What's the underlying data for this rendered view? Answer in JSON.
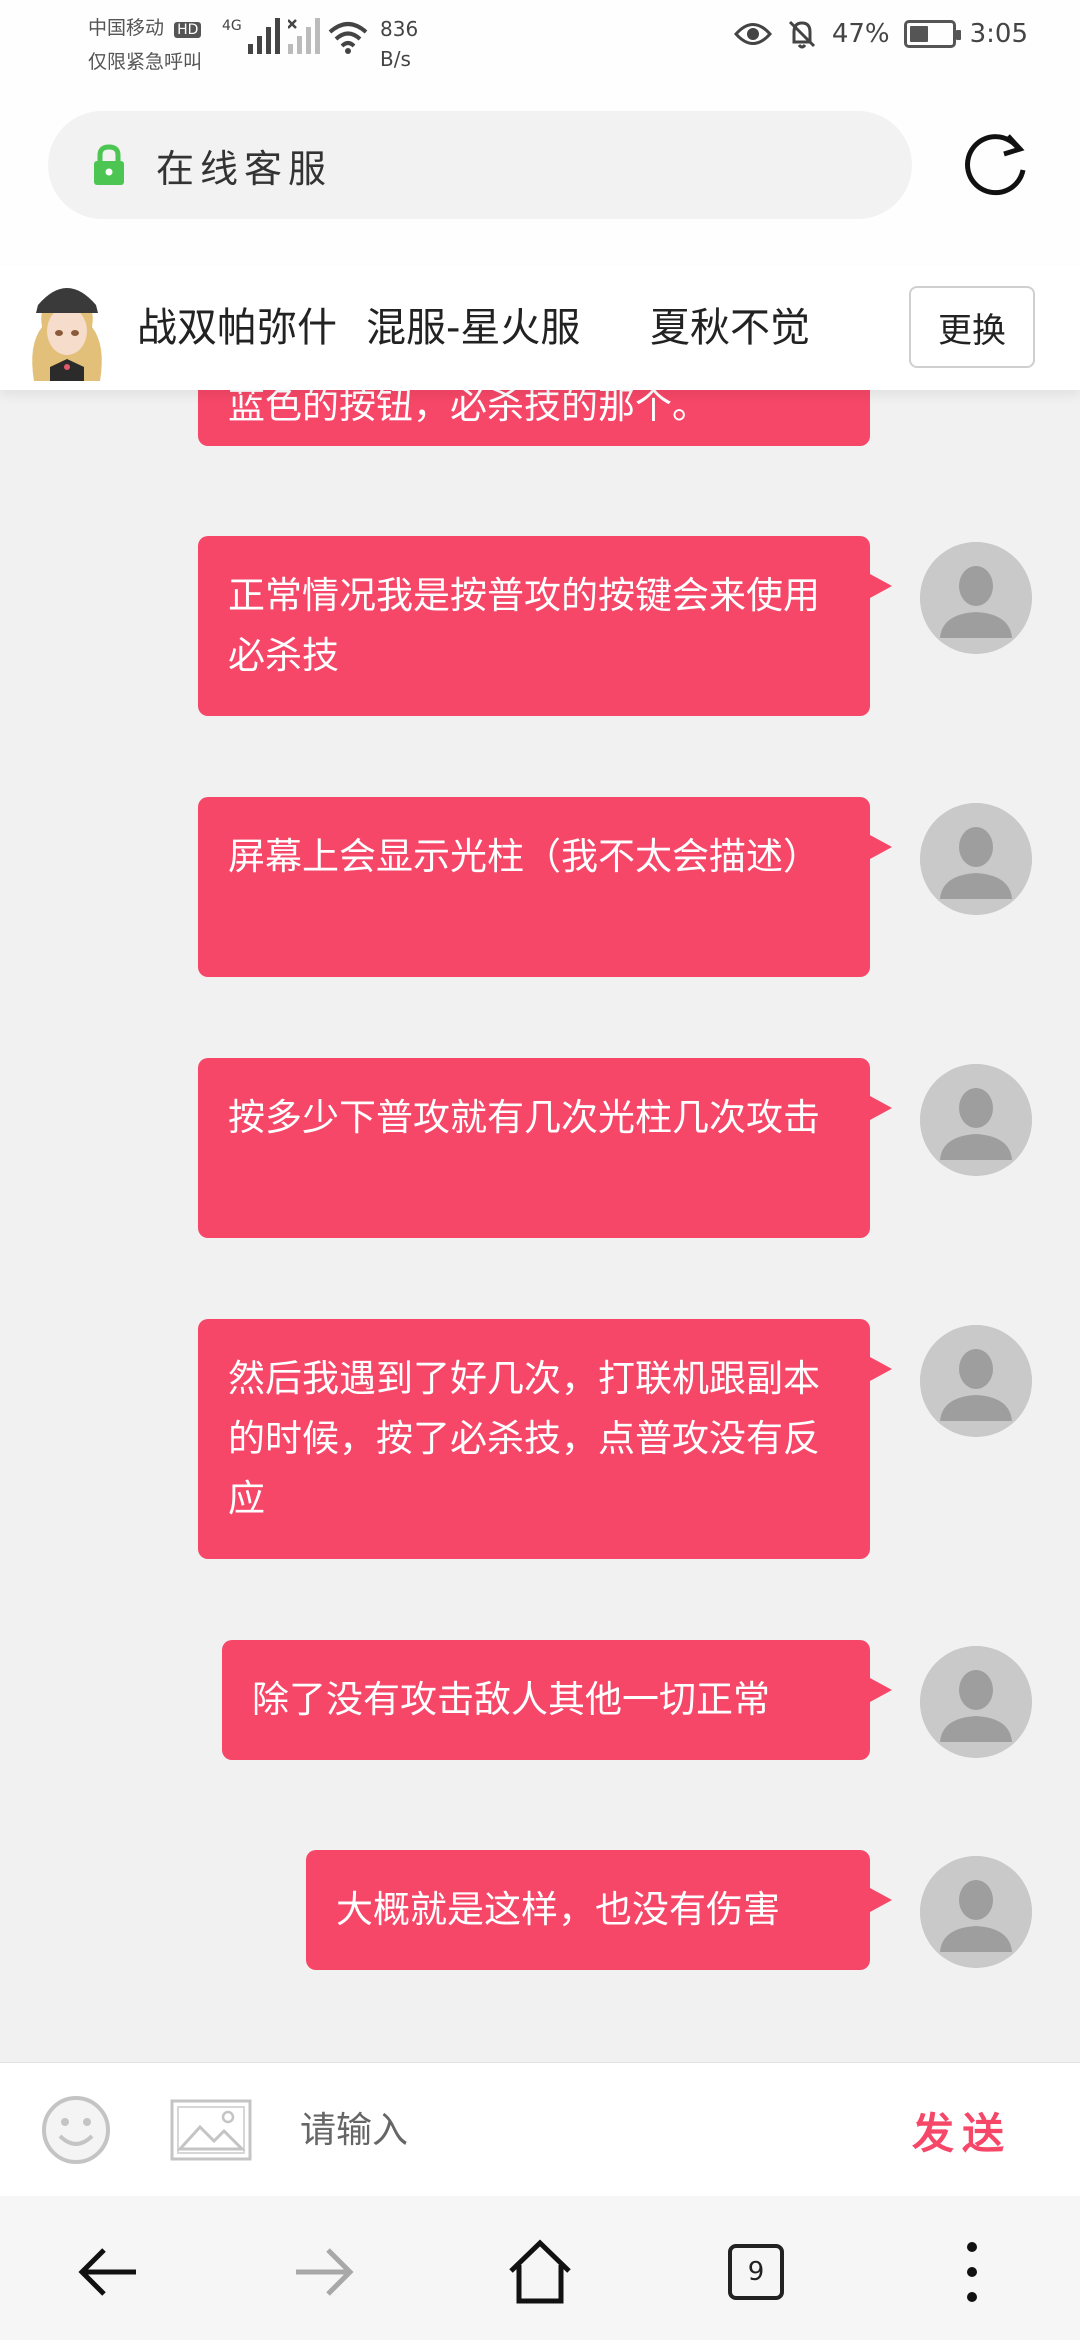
{
  "status_bar": {
    "carrier_line1": "中国移动",
    "carrier_badge": "HD",
    "carrier_line2": "仅限紧急呼叫",
    "network_type": "4G",
    "speed_value": "836",
    "speed_unit": "B/s",
    "battery": "47%",
    "battery_level": 0.47,
    "time": "3:05"
  },
  "browser": {
    "page_title": "在线客服",
    "lock_icon": "lock-icon",
    "refresh_icon": "refresh-icon"
  },
  "chat_header": {
    "game_name": "战双帕弥什",
    "server_name": "混服-星火服",
    "role_name": "夏秋不觉",
    "change_label": "更换"
  },
  "messages": [
    {
      "text": "蓝色的按钮，必杀技的那个。"
    },
    {
      "text": "正常情况我是按普攻的按键会来使用必杀技"
    },
    {
      "text": "屏幕上会显示光柱（我不太会描述）"
    },
    {
      "text": "按多少下普攻就有几次光柱几次攻击"
    },
    {
      "text": "然后我遇到了好几次，打联机跟副本的时候，按了必杀技，点普攻没有反应"
    },
    {
      "text": "除了没有攻击敌人其他一切正常"
    },
    {
      "text": "大概就是这样，也没有伤害"
    }
  ],
  "input_bar": {
    "placeholder": "请输入",
    "send_label": "发送",
    "emoji_icon": "smiley-icon",
    "image_icon": "image-icon"
  },
  "nav": {
    "back_icon": "back-arrow-icon",
    "forward_icon": "forward-arrow-icon",
    "home_icon": "home-icon",
    "tab_count": "9",
    "menu_icon": "more-vertical-icon"
  },
  "colors": {
    "bubble": "#f64768",
    "send": "#f64768",
    "lock": "#4cc553"
  }
}
